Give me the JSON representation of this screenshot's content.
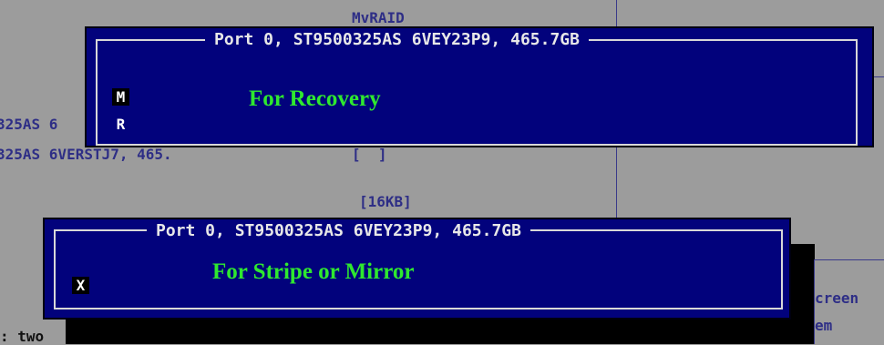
{
  "background": {
    "header_text": "MvRAID",
    "disk_line_1": "325AS 6",
    "disk_line_2": "325AS 6VERSTJ7, 465.",
    "bracket_empty": "[  ]",
    "stripe_size": "[16KB]",
    "footer_left": ": two",
    "right_line_1": "creen",
    "right_line_2": "em"
  },
  "recovery_dialog": {
    "title": "Port 0, ST9500325AS 6VEY23P9, 465.7GB",
    "items": [
      {
        "key": "M",
        "selected": true
      },
      {
        "key": "R",
        "selected": false
      }
    ],
    "annotation": "For Recovery"
  },
  "stripe_dialog": {
    "title": "Port 0, ST9500325AS 6VEY23P9, 465.7GB",
    "items": [
      {
        "key": "X",
        "selected": true
      }
    ],
    "annotation": "For Stripe or Mirror"
  },
  "colors": {
    "dialog_bg": "#02027c",
    "annotation": "#2fe82f",
    "screen_bg": "#9c9c9c",
    "bg_text": "#2e2e86"
  }
}
